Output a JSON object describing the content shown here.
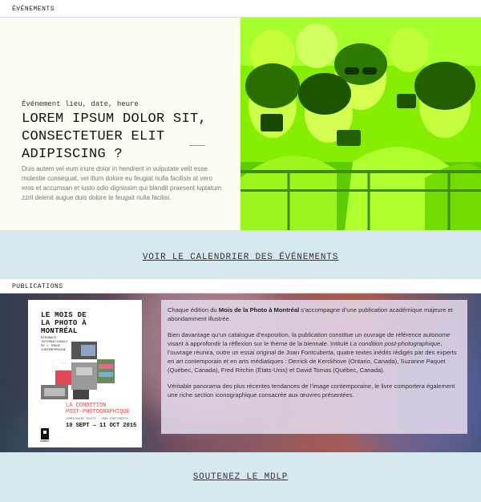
{
  "events": {
    "section_label": "ÉVÉNEMENTS",
    "meta": "Événement lieu, date, heure",
    "title": "LOREM IPSUM DOLOR SIT, CONSECTETUER ELIT ADIPISCING ?",
    "description": "Duis autem vel eum iriure dolor in hendrerit in vulputate velit esse molestie consequat, vel illum dolore eu feugiat nulla facilisis at vero eros et accumsan et iusto odio dignissim qui blandit praesent luptatum zzril delenit augue duis dolore te feugait nulla facilisi.",
    "photo_tint": "#7ae200",
    "calendar_link": "VOIR LE CALENDRIER DES ÉVÉNEMENTS"
  },
  "publications": {
    "section_label": "PUBLICATIONS",
    "book": {
      "title_line1": "LE MOIS DE",
      "title_line2": "LA PHOTO À",
      "title_line3": "MONTRÉAL",
      "subtitle_line1": "BIENNALE",
      "subtitle_line2": "INTERNATIONALE",
      "subtitle_line3": "DE L'IMAGE",
      "subtitle_line4": "CONTEMPORAINE",
      "theme_line1": "LA CONDITION",
      "theme_line2": "POST-PHOTOGRAPHIQUE",
      "credit": "COMMISSAIRE INVITÉ : JOAN FONTCUBERTA",
      "dates": "10 SEPT — 11 OCT 2015",
      "logo_text": "KERBER"
    },
    "para1_prefix": "Chaque édition du ",
    "para1_bold": "Mois de la Photo à Montréal",
    "para1_suffix": " s’accompagne d’une publication académique majeure et abondamment illustrée.",
    "para2_prefix": "Bien davantage qu’un catalogue d’exposition, la publication constitue un ouvrage de référence autonome visant à approfondir la réflexion sur le thème de la biennale. Intitulé ",
    "para2_italic": "La condition post-photographique",
    "para2_suffix": ", l’ouvrage réunira, outre un essai original de Joan Fontcuberta, quatre textes inédits rédigés par des experts en art contemporain et en arts médiatiques : Derrick de Kerckhove (Ontario, Canada), Suzanne Paquet (Québec, Canada), Fred Ritchin (États-Unis) et David Tomas (Québec, Canada).",
    "para3": "Véritable panorama des plus récentes tendances de l’image contemporaine, le livre comportera également une riche section iconographique consacrée aux œuvres présentées."
  },
  "support_link": "SOUTENEZ LE MDLP"
}
